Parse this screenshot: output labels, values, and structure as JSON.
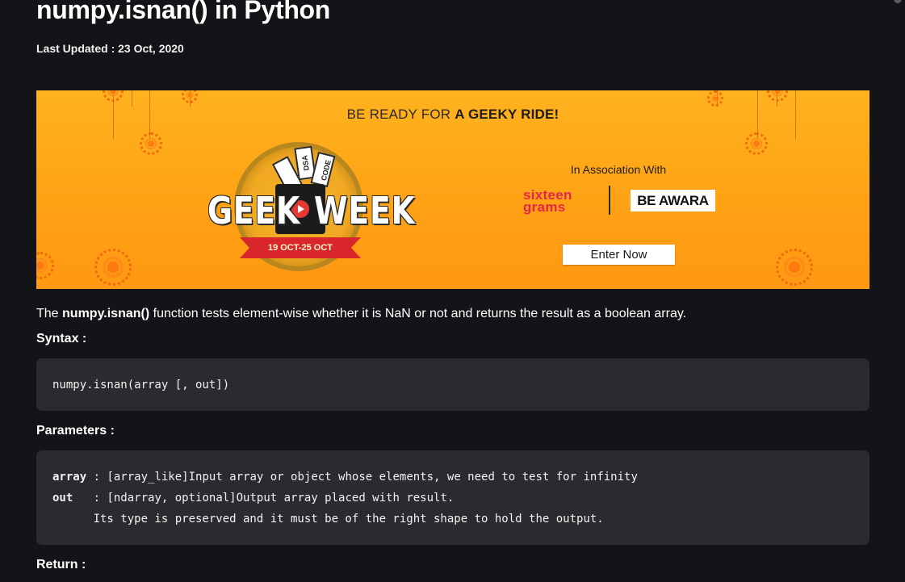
{
  "article": {
    "title": "numpy.isnan() in Python",
    "last_updated": "Last Updated : 23 Oct, 2020"
  },
  "banner": {
    "headline_prefix": "BE READY FOR ",
    "headline_bold": "A GEEKY RIDE!",
    "event_word_1": "GEEK",
    "event_word_2": "WEEK",
    "ticket_1": "DSA",
    "ticket_2": "CODE",
    "dates": "19 OCT-25 OCT",
    "association_text": "In Association With",
    "sponsor_1_line_1": "sixteen",
    "sponsor_1_line_2": "grams",
    "sponsor_2": "BE AWARA",
    "cta": "Enter Now",
    "colors": {
      "background": "#ffa114",
      "ribbon": "#d8262a",
      "sponsor_1": "#e5264b"
    }
  },
  "content": {
    "intro_prefix": "The ",
    "intro_function": "numpy.isnan()",
    "intro_suffix": " function tests element-wise whether it is NaN or not and returns the result as a boolean array.",
    "syntax_heading": "Syntax :",
    "syntax_code": "numpy.isnan(array [, out])",
    "parameters_heading": "Parameters :",
    "parameters": [
      {
        "name": "array",
        "separator": " : ",
        "description": "[array_like]Input array or object whose elements, we need to test for infinity"
      },
      {
        "name": "out  ",
        "separator": " : ",
        "description": "[ndarray, optional]Output array placed with result."
      }
    ],
    "parameters_continuation": "      Its type is preserved and it must be of the right shape to hold the output.",
    "return_heading": "Return :"
  }
}
